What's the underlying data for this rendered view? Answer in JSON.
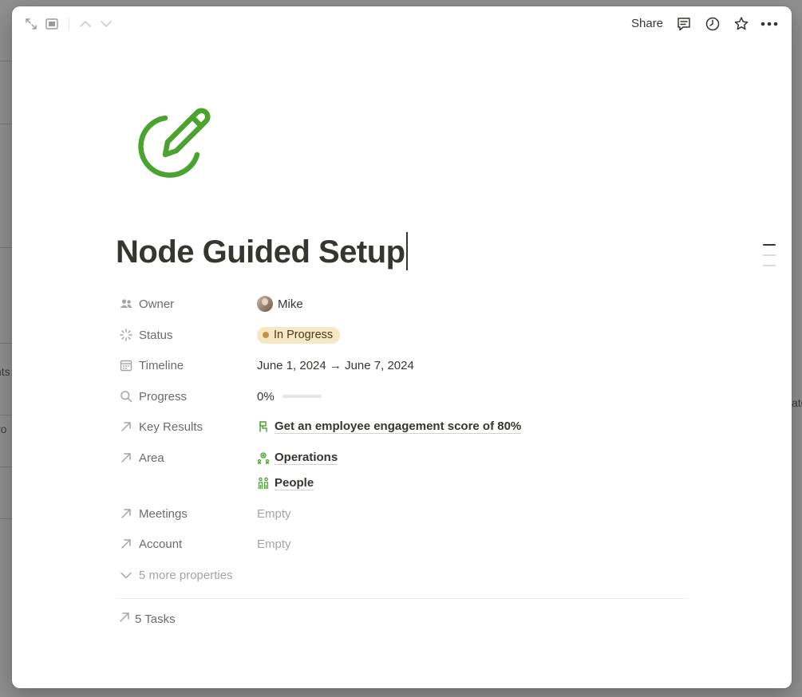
{
  "topbar": {
    "share_label": "Share",
    "icons": [
      "expand-icon",
      "sidebar-peek-icon",
      "chevron-up-icon",
      "chevron-down-icon",
      "comment-icon",
      "history-icon",
      "star-icon",
      "more-icon"
    ]
  },
  "page": {
    "icon": "pencil-edit-icon",
    "icon_color": "#4aa32c",
    "title": "Node Guided Setup"
  },
  "properties": {
    "owner": {
      "label": "Owner",
      "value": "Mike"
    },
    "status": {
      "label": "Status",
      "value": "In Progress",
      "color": "#f8e7c4"
    },
    "timeline": {
      "label": "Timeline",
      "value": "June 1, 2024 → June 7, 2024"
    },
    "progress": {
      "label": "Progress",
      "value": "0%",
      "fraction": 0
    },
    "key_results": {
      "label": "Key Results",
      "value": "Get an employee engagement score of 80%"
    },
    "area": {
      "label": "Area",
      "values": [
        "Operations",
        "People"
      ]
    },
    "meetings": {
      "label": "Meetings",
      "value": "Empty"
    },
    "account": {
      "label": "Account",
      "value": "Empty"
    },
    "more": {
      "label": "5 more properties"
    }
  },
  "tasks": {
    "label": "5 Tasks"
  },
  "background": {
    "fragments": [
      "nts",
      "ro",
      "ate"
    ]
  }
}
